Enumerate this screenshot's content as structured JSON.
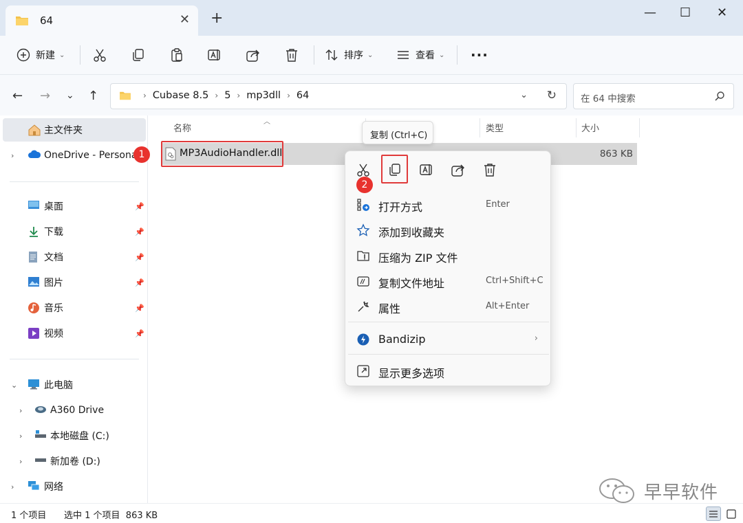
{
  "tab": {
    "title": "64"
  },
  "toolbar": {
    "new_label": "新建",
    "sort_label": "排序",
    "view_label": "查看"
  },
  "address": {
    "crumbs": [
      "Cubase 8.5",
      "5",
      "mp3dll",
      "64"
    ]
  },
  "search": {
    "placeholder": "在 64 中搜索"
  },
  "sidebar": {
    "home": "主文件夹",
    "onedrive": "OneDrive - Persona",
    "quick": [
      {
        "label": "桌面",
        "icon": "desktop-icon"
      },
      {
        "label": "下载",
        "icon": "download-icon"
      },
      {
        "label": "文档",
        "icon": "document-icon"
      },
      {
        "label": "图片",
        "icon": "pictures-icon"
      },
      {
        "label": "音乐",
        "icon": "music-icon"
      },
      {
        "label": "视频",
        "icon": "video-icon"
      }
    ],
    "this_pc": "此电脑",
    "drives": [
      {
        "label": "A360 Drive",
        "icon": "cloud-drive-icon"
      },
      {
        "label": "本地磁盘 (C:)",
        "icon": "local-disk-icon"
      },
      {
        "label": "新加卷 (D:)",
        "icon": "volume-icon"
      }
    ],
    "network": "网络"
  },
  "columns": {
    "name": "名称",
    "type": "类型",
    "size": "大小"
  },
  "file": {
    "name": "MP3AudioHandler.dll",
    "size": "863 KB"
  },
  "badges": {
    "one": "1",
    "two": "2"
  },
  "tooltip": "复制 (Ctrl+C)",
  "context_menu": {
    "items": [
      {
        "label": "打开方式",
        "shortcut": "Enter"
      },
      {
        "label": "添加到收藏夹",
        "shortcut": ""
      },
      {
        "label": "压缩为 ZIP 文件",
        "shortcut": ""
      },
      {
        "label": "复制文件地址",
        "shortcut": "Ctrl+Shift+C"
      },
      {
        "label": "属性",
        "shortcut": "Alt+Enter"
      }
    ],
    "bandizip": "Bandizip",
    "more": "显示更多选项"
  },
  "status": {
    "count": "1 个项目",
    "selected": "选中 1 个项目  863 KB"
  },
  "watermark": "早早软件",
  "colors": {
    "highlight": "#e03a3a",
    "accent": "#0067c0"
  }
}
